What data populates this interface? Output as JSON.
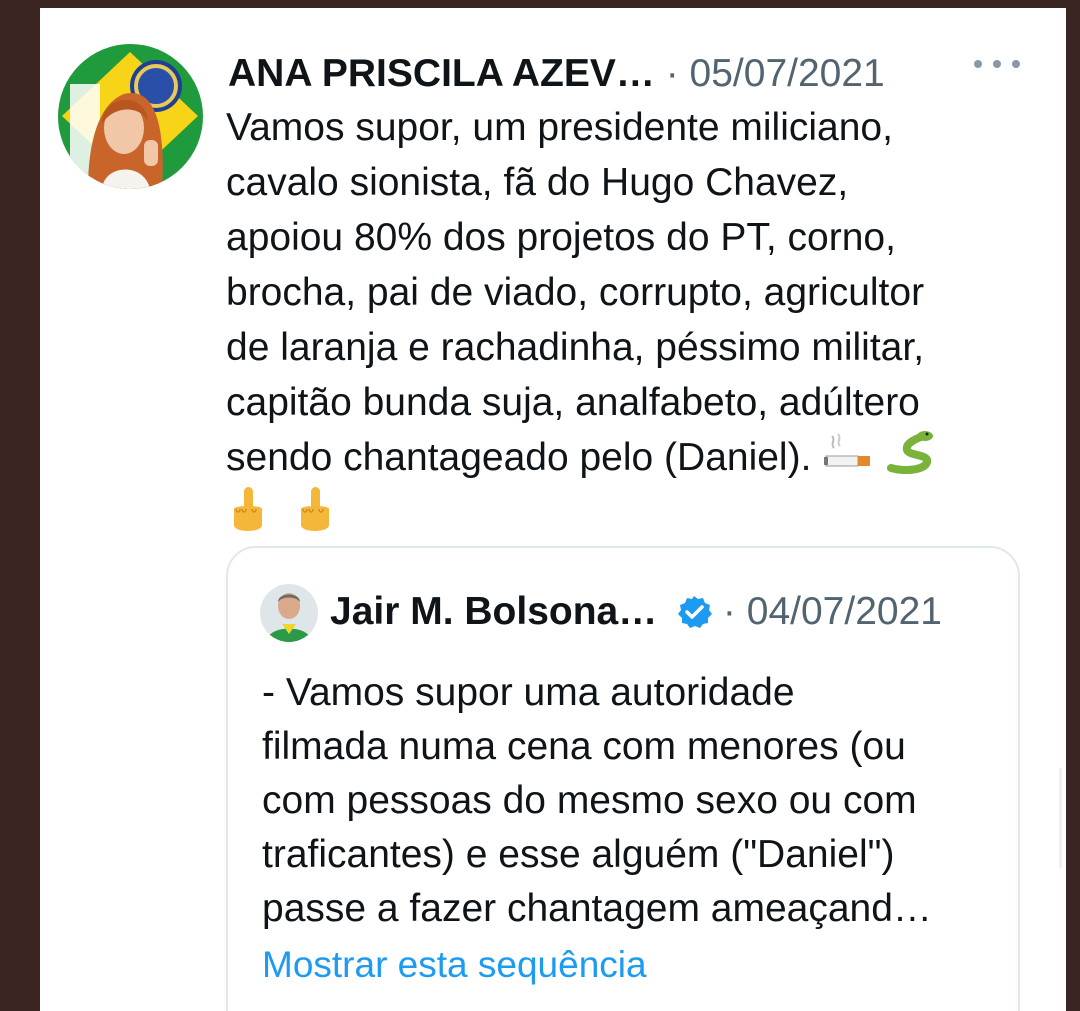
{
  "tweet": {
    "author_name": "ANA PRISCILA AZEV…",
    "separator": "·",
    "date": "05/07/2021",
    "avatar_icon": "profile-photo-brazil-flag",
    "more_icon": "more-options-icon",
    "body_lines": [
      "Vamos supor, um presidente miliciano,",
      "cavalo sionista, fã do Hugo Chavez,",
      "apoiou 80% dos projetos do PT, corno,",
      "brocha, pai de viado, corrupto, agricultor",
      "de laranja e rachadinha, péssimo militar,",
      "capitão bunda suja, analfabeto, adúltero",
      "sendo chantageado pelo (Daniel)."
    ],
    "emojis": [
      "cigarette",
      "snake",
      "middle-finger",
      "middle-finger"
    ]
  },
  "quoted_tweet": {
    "author_name": "Jair M. Bolsona…",
    "verified_icon": "verified-badge-icon",
    "separator": "·",
    "date": "04/07/2021",
    "body_lines": [
      "- Vamos supor uma autoridade",
      "filmada numa cena com menores (ou",
      "com pessoas do mesmo sexo ou com",
      "traficantes) e esse alguém (\"Daniel\")",
      "passe a fazer chantagem ameaçand…"
    ],
    "show_thread_label": "Mostrar esta sequência"
  },
  "colors": {
    "text_primary": "#0f1419",
    "text_secondary": "#536471",
    "link": "#1d9bf0",
    "verified": "#1d9bf0",
    "border": "#e1e8ed",
    "outer_frame": "#3a2522"
  }
}
